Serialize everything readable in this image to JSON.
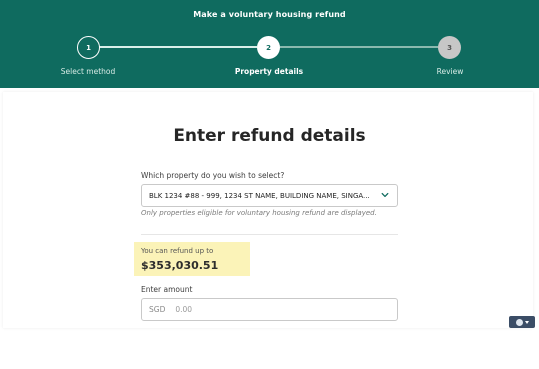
{
  "header": {
    "title": "Make a voluntary housing refund",
    "steps": [
      {
        "number": "1",
        "label": "Select method"
      },
      {
        "number": "2",
        "label": "Property details"
      },
      {
        "number": "3",
        "label": "Review"
      }
    ]
  },
  "form": {
    "title": "Enter refund details",
    "property_question": "Which property do you wish to select?",
    "selected_property": "BLK 1234 #88 - 999, 1234 ST NAME, BUILDING NAME, SINGA...",
    "property_hint": "Only properties eligible for voluntary housing refund are displayed.",
    "refund_limit_label": "You can refund up to",
    "refund_limit_amount": "$353,030.51",
    "amount_label": "Enter amount",
    "currency": "SGD",
    "amount_placeholder": "0.00"
  },
  "icons": {
    "dropdown": "chevron-down-icon",
    "language": "globe-icon"
  },
  "colors": {
    "brand": "#0f6b5f",
    "highlight": "#fbf3b8",
    "step_inactive": "#c7c7c7"
  }
}
